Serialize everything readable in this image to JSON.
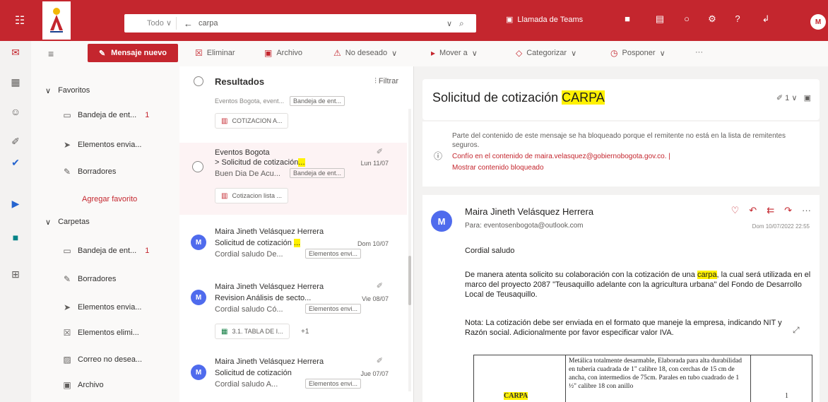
{
  "topbar": {
    "search_scope": "Todo",
    "search_query": "carpa",
    "teams_label": "Llamada de Teams",
    "avatar_initial": "M"
  },
  "toolbar": {
    "new_message": "Mensaje nuevo",
    "delete": "Eliminar",
    "archive": "Archivo",
    "junk": "No deseado",
    "move": "Mover a",
    "categorize": "Categorizar",
    "snooze": "Posponer",
    "more": "···"
  },
  "folders": {
    "favorites_header": "Favoritos",
    "favorites": [
      {
        "label": "Bandeja de ent...",
        "count": "1"
      },
      {
        "label": "Elementos envia...",
        "count": ""
      },
      {
        "label": "Borradores",
        "count": ""
      }
    ],
    "add_favorite": "Agregar favorito",
    "folders_header": "Carpetas",
    "items": [
      {
        "label": "Bandeja de ent...",
        "count": "1"
      },
      {
        "label": "Borradores",
        "count": ""
      },
      {
        "label": "Elementos envia...",
        "count": ""
      },
      {
        "label": "Elementos elimi...",
        "count": ""
      },
      {
        "label": "Correo no desea...",
        "count": ""
      },
      {
        "label": "Archivo",
        "count": ""
      }
    ]
  },
  "list": {
    "title": "Resultados",
    "filter": "Filtrar",
    "partial": {
      "preview": "Eventos Bogota, event...",
      "tag": "Bandeja de ent...",
      "attachment": "COTIZACION A..."
    },
    "messages": [
      {
        "sender": "Eventos Bogota",
        "subject": "> Solicitud de cotización",
        "subject_hl": "...",
        "date": "Lun 11/07",
        "preview": "Buen Dia De Acu...",
        "tag": "Bandeja de ent...",
        "attachment": "Cotizacion lista ..."
      },
      {
        "sender": "Maira Jineth Velásquez Herrera",
        "subject": "Solicitud de cotización",
        "subject_hl": "...",
        "date": "Dom 10/07",
        "preview": "Cordial saludo De...",
        "tag": "Elementos envi...",
        "avatar": "M"
      },
      {
        "sender": "Maira Jineth Velásquez Herrera",
        "subject": "Revision Análisis de secto...",
        "date": "Vie 08/07",
        "preview": "Cordial saludo Có...",
        "tag": "Elementos envi...",
        "attachment": "3.1. TABLA DE I...",
        "extra": "+1",
        "avatar": "M"
      },
      {
        "sender": "Maira Jineth Velásquez Herrera",
        "subject": "Solicitud de cotización",
        "date": "Jue 07/07",
        "preview": "Cordial saludo A...",
        "tag": "Elementos envi...",
        "avatar": "M"
      }
    ]
  },
  "reading": {
    "subject": "Solicitud de cotización",
    "subject_hl": "CARPA",
    "count": "1",
    "warning_text": "Parte del contenido de este mensaje se ha bloqueado porque el remitente no está en la lista de remitentes seguros.",
    "trust_link": "Confío en el contenido de maira.velasquez@gobiernobogota.gov.co. |",
    "show_blocked": "Mostrar contenido bloqueado",
    "sender": "Maira Jineth Velásquez Herrera",
    "to_label": "Para:",
    "to": "eventosenbogota@outlook.com",
    "date": "Dom 10/07/2022 22:55",
    "avatar": "M",
    "greeting": "Cordial saludo",
    "para1_a": "De manera atenta solicito su colaboración con la cotización de una",
    "para1_hl": "carpa",
    "para1_b": ", la cual será utilizada en el marco del proyecto 2087 \"Teusaquillo adelante con la agricultura urbana\" del Fondo de Desarrollo Local de Teusaquillo.",
    "para2": "Nota: La cotización debe ser enviada en el formato que maneje la empresa, indicando NIT y Razón social. Adicionalmente por favor especificar valor IVA.",
    "table": {
      "item": "CARPA",
      "description": "Metálica totalmente desarmable, Elaborada para alta durabilidad en tubería cuadrada de 1\" calibre 18, con cerchas de 15 cm de ancha, con intermedios de 75cm. Parales en tubo cuadrado de 1 ½\" calibre 18 con anillo",
      "qty": "1"
    }
  }
}
